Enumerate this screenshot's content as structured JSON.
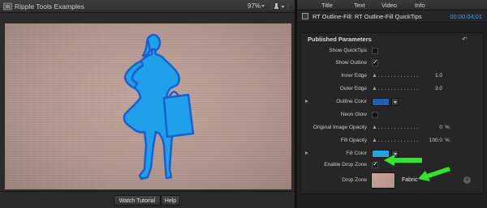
{
  "viewer": {
    "title": "Ripple Tools Examples",
    "zoom": "97%",
    "watch_tutorial": "Watch Tutorial",
    "help": "Help",
    "silhouette_color": "#1ea0ea"
  },
  "inspector": {
    "tabs": [
      "Title",
      "Text",
      "Video",
      "Info"
    ],
    "clip_name": "RT Outline-Fill: RT Outline-Fill QuickTips",
    "timecode": "00:00:04;01",
    "params_title": "Published Parameters",
    "params": {
      "show_quicktips": {
        "label": "Show QuickTips",
        "checked": false
      },
      "show_outline": {
        "label": "Show Outline",
        "checked": true
      },
      "inner_edge": {
        "label": "Inner Edge",
        "value": "1.0"
      },
      "outer_edge": {
        "label": "Outer Edge",
        "value": "3.0"
      },
      "outline_color": {
        "label": "Outline Color",
        "color": "#1f5fb8"
      },
      "neon_glow": {
        "label": "Neon Glow",
        "checked": false
      },
      "original_image_opacity": {
        "label": "Original Image Opacity",
        "value": "0",
        "unit": "%"
      },
      "fill_opacity": {
        "label": "Fill Opacity",
        "value": "100.0",
        "unit": "%"
      },
      "fill_color": {
        "label": "Fill Color",
        "color": "#22a4de"
      },
      "enable_drop_zone": {
        "label": "Enable Drop Zone",
        "checked": true
      },
      "drop_zone": {
        "label": "Drop Zone",
        "name": "Fabric"
      }
    }
  },
  "colors": {
    "accent_arrow": "#2ee82a",
    "timecode": "#4d9ad8"
  }
}
